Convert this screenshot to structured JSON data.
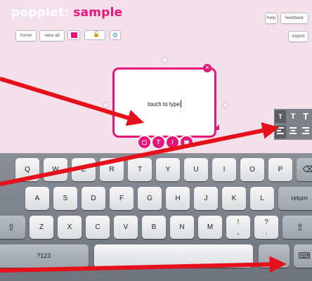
{
  "header": {
    "app_name": "popplet:",
    "document_title": "sample",
    "help_label": "help",
    "feedback_label": "feedback",
    "export_label": "export"
  },
  "toolbar": {
    "home_label": "home",
    "view_all_label": "view all",
    "color_swatch": "#e6157a"
  },
  "popplet": {
    "placeholder_text": "touch to type",
    "accent_color": "#e6157a",
    "tools": [
      {
        "name": "frame-tool",
        "glyph": "▢"
      },
      {
        "name": "text-tool",
        "glyph": "T"
      },
      {
        "name": "draw-tool",
        "glyph": "/"
      },
      {
        "name": "image-tool",
        "glyph": "▣"
      }
    ]
  },
  "format_panel": {
    "font_sizes": [
      "T",
      "T",
      "T"
    ],
    "alignments": [
      "align-left",
      "align-center",
      "align-right"
    ]
  },
  "keyboard": {
    "row1": [
      "Q",
      "W",
      "E",
      "R",
      "T",
      "Y",
      "U",
      "I",
      "O",
      "P"
    ],
    "row2": [
      "A",
      "S",
      "D",
      "F",
      "G",
      "H",
      "J",
      "K",
      "L"
    ],
    "row3": [
      "Z",
      "X",
      "C",
      "V",
      "B",
      "N",
      "M",
      "!",
      "?"
    ],
    "row3_sub": [
      ",",
      "."
    ],
    "return_label": "return",
    "numbers_label": ".?123",
    "backspace_glyph": "⌫",
    "shift_glyph": "⇧"
  },
  "annotations": {
    "arrow_color": "#e5101a"
  }
}
